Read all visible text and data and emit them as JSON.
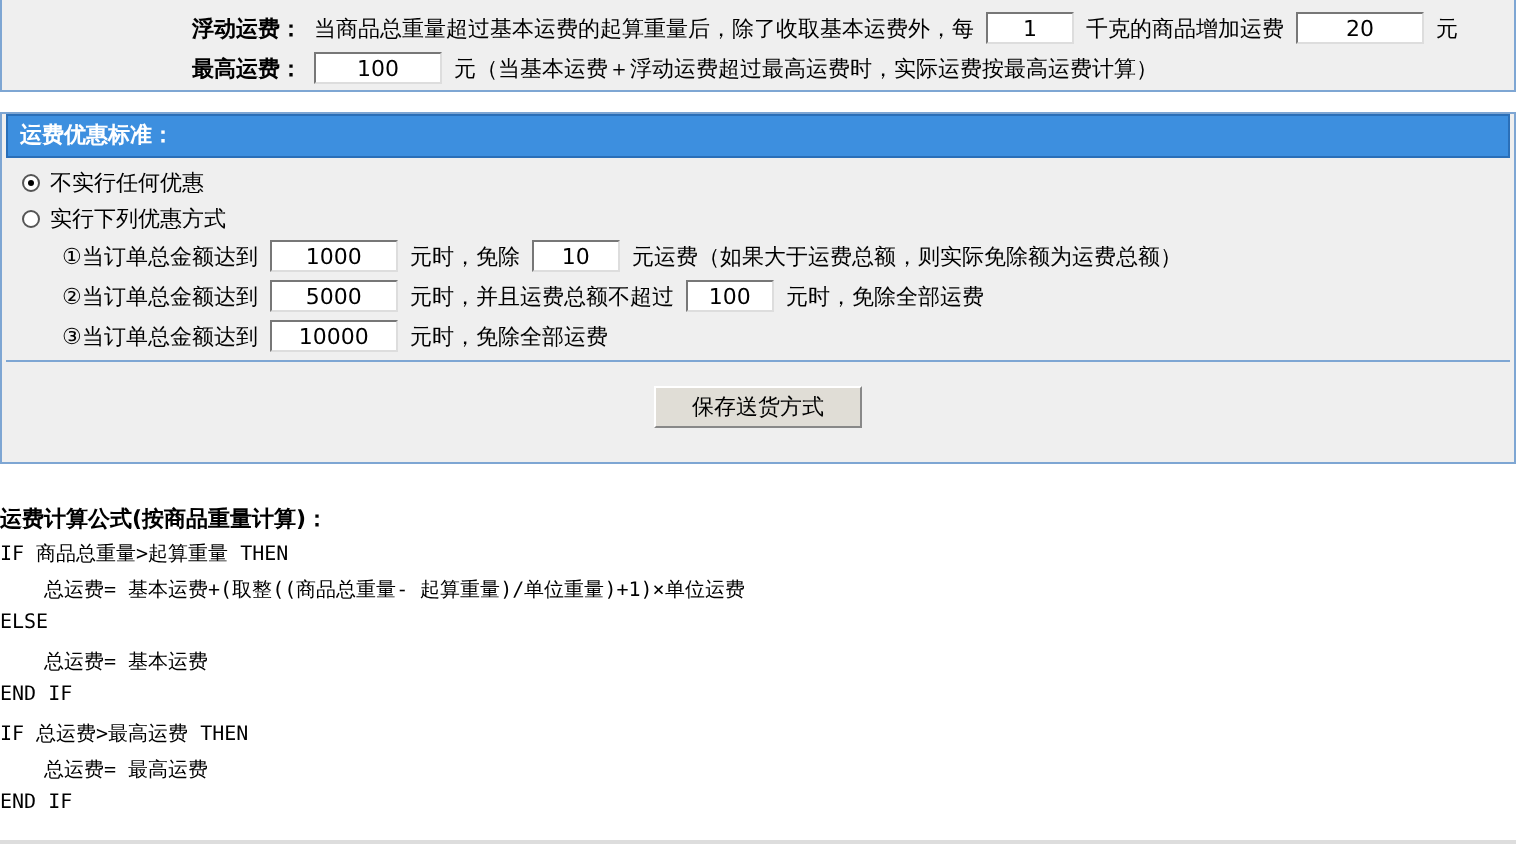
{
  "freight_settings": [
    {
      "label": "浮动运费：",
      "parts": [
        {
          "kind": "text",
          "text": "当商品总重量超过基本运费的起算重量后，除了收取基本运费外，每"
        },
        {
          "kind": "short_input",
          "value": "1"
        },
        {
          "kind": "text",
          "text": "千克的商品增加运费"
        },
        {
          "kind": "input",
          "value": "20"
        },
        {
          "kind": "text",
          "text": "元"
        }
      ]
    },
    {
      "label": "最高运费：",
      "parts": [
        {
          "kind": "input",
          "value": "100"
        },
        {
          "kind": "text",
          "text": "元（当基本运费＋浮动运费超过最高运费时，实际运费按最高运费计算）"
        }
      ]
    }
  ],
  "discount_section": {
    "title": "运费优惠标准：",
    "options": [
      {
        "label": "不实行任何优惠",
        "selected": true
      },
      {
        "label": "实行下列优惠方式",
        "selected": false
      }
    ],
    "rules": [
      [
        {
          "kind": "text",
          "text": "①当订单总金额达到"
        },
        {
          "kind": "input",
          "value": "1000"
        },
        {
          "kind": "text",
          "text": "元时，免除"
        },
        {
          "kind": "short_input",
          "value": "10"
        },
        {
          "kind": "text",
          "text": "元运费（如果大于运费总额，则实际免除额为运费总额）"
        }
      ],
      [
        {
          "kind": "text",
          "text": "②当订单总金额达到"
        },
        {
          "kind": "input",
          "value": "5000"
        },
        {
          "kind": "text",
          "text": "元时，并且运费总额不超过"
        },
        {
          "kind": "short_input",
          "value": "100"
        },
        {
          "kind": "text",
          "text": "元时，免除全部运费"
        }
      ],
      [
        {
          "kind": "text",
          "text": "③当订单总金额达到"
        },
        {
          "kind": "input",
          "value": "10000"
        },
        {
          "kind": "text",
          "text": "元时，免除全部运费"
        }
      ]
    ]
  },
  "save_button": "保存送货方式",
  "formula": {
    "title": "运费计算公式(按商品重量计算)：",
    "lines": [
      {
        "text": "IF 商品总重量>起算重量 THEN",
        "indented": false
      },
      {
        "text": "总运费= 基本运费+(取整((商品总重量- 起算重量)/单位重量)+1)×单位运费",
        "indented": true
      },
      {
        "text": "ELSE",
        "indented": false
      },
      {
        "text": "总运费= 基本运费",
        "indented": true
      },
      {
        "text": "END IF",
        "indented": false
      },
      {
        "text": "IF 总运费>最高运费 THEN",
        "indented": false
      },
      {
        "text": "总运费= 最高运费",
        "indented": true
      },
      {
        "text": "END IF",
        "indented": false
      }
    ]
  }
}
